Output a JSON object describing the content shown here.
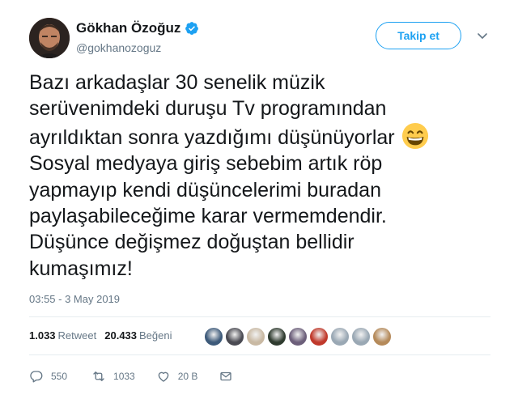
{
  "author": {
    "name": "Gökhan Özoğuz",
    "handle": "@gokhanozoguz",
    "verified": true
  },
  "follow_button": {
    "label": "Takip et"
  },
  "tweet": {
    "lines": [
      "Bazı arkadaşlar 30 senelik müzik",
      "serüvenimdeki duruşu Tv programından",
      "ayrıldıktan  sonra yazdığımı düşünüyorlar",
      "Sosyal medyaya giriş sebebim artık röp",
      "yapmayıp kendi düşüncelerimi buradan",
      "paylaşabileceğime karar vermemdendir.",
      "Düşünce değişmez doğuştan bellidir",
      "kumaşımız!"
    ],
    "emoji": "grinning-face-with-smiling-eyes",
    "timestamp": "03:55 - 3 May 2019"
  },
  "stats": {
    "retweets_count": "1.033",
    "retweets_label": "Retweet",
    "likes_count": "20.433",
    "likes_label": "Beğeni"
  },
  "liker_avatars": [
    "#3d5a7a",
    "#4a4a52",
    "#c9b9a3",
    "#2f3b2f",
    "#6c5f7a",
    "#c0392b",
    "#9aa8b4",
    "#9aa8b4",
    "#b58a5a"
  ],
  "actions": {
    "replies": "550",
    "retweets": "1033",
    "likes": "20 B"
  },
  "colors": {
    "accent": "#1da1f2",
    "muted": "#657786"
  }
}
